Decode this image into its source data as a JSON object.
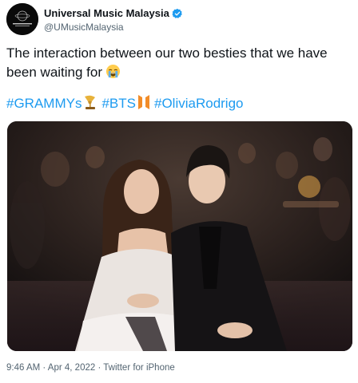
{
  "author": {
    "display_name": "Universal Music Malaysia",
    "handle": "@UMusicMalaysia",
    "verified": true,
    "avatar_icon": "universal-music-logo-icon"
  },
  "tweet": {
    "text": "The interaction between our two besties that we have been waiting for",
    "emoji_icon": "loudly-crying-face-icon",
    "hashtags": [
      "#GRAMMYs",
      "#BTS",
      "#OliviaRodrigo"
    ],
    "hashtag_icons": [
      "grammy-gramophone-icon",
      "bts-logo-icon"
    ],
    "media_alt_icon": "photo-two-people-seated-icon"
  },
  "meta": {
    "time": "9:46 AM",
    "separator1": " · ",
    "date": "Apr 4, 2022",
    "separator2": " · ",
    "source": "Twitter for iPhone"
  },
  "colors": {
    "link": "#1d9bf0",
    "secondary_text": "#536471",
    "verified_badge": "#1d9bf0"
  }
}
